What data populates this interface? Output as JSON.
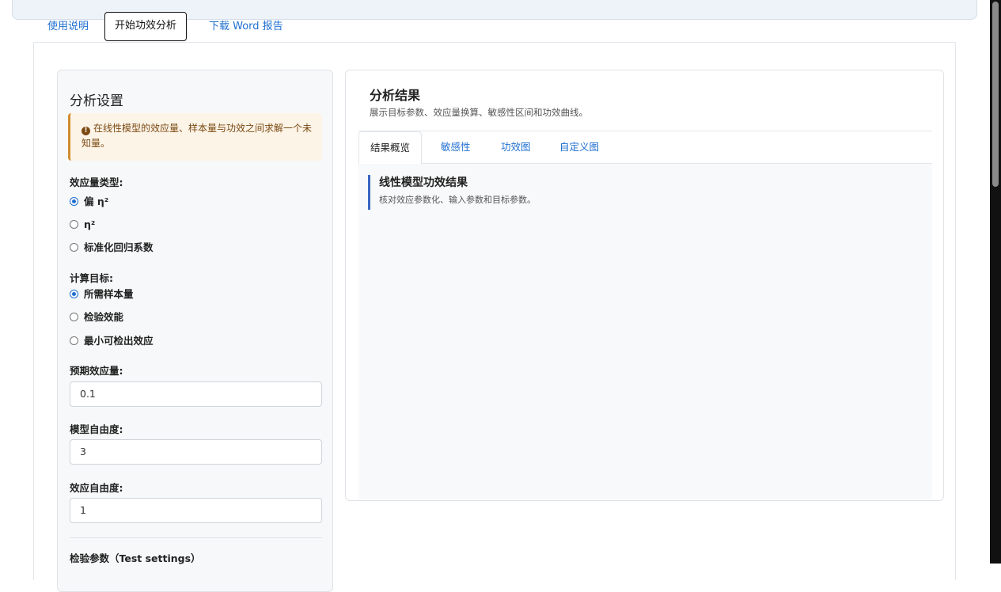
{
  "nav": {
    "tabs": [
      {
        "label": "使用说明"
      },
      {
        "label": "开始功效分析"
      },
      {
        "label": "下载 Word 报告"
      }
    ]
  },
  "sidebar": {
    "title": "分析设置",
    "note": "在线性模型的效应量、样本量与功效之间求解一个未知量。",
    "effect_type": {
      "label": "效应量类型:",
      "options": [
        "偏 η²",
        "η²",
        "标准化回归系数"
      ],
      "selected": "偏 η²"
    },
    "target": {
      "label": "计算目标:",
      "options": [
        "所需样本量",
        "检验效能",
        "最小可检出效应"
      ],
      "selected": "所需样本量"
    },
    "expected_effect": {
      "label": "预期效应量:",
      "value": "0.1"
    },
    "model_df": {
      "label": "模型自由度:",
      "value": "3"
    },
    "effect_df": {
      "label": "效应自由度:",
      "value": "1"
    },
    "test_settings_label": "检验参数（Test settings）"
  },
  "main": {
    "title": "分析结果",
    "subtitle": "展示目标参数、效应量换算、敏感性区间和功效曲线。",
    "tabs": [
      {
        "label": "结果概览"
      },
      {
        "label": "敏感性"
      },
      {
        "label": "功效图"
      },
      {
        "label": "自定义图"
      }
    ],
    "result_title": "线性模型功效结果",
    "result_subtitle": "核对效应参数化、输入参数和目标参数。"
  },
  "colors": {
    "accent": "#1f6fd1",
    "note_bg": "#fdf4e8",
    "note_border": "#d28b2f",
    "result_bar": "#3a66c4"
  }
}
